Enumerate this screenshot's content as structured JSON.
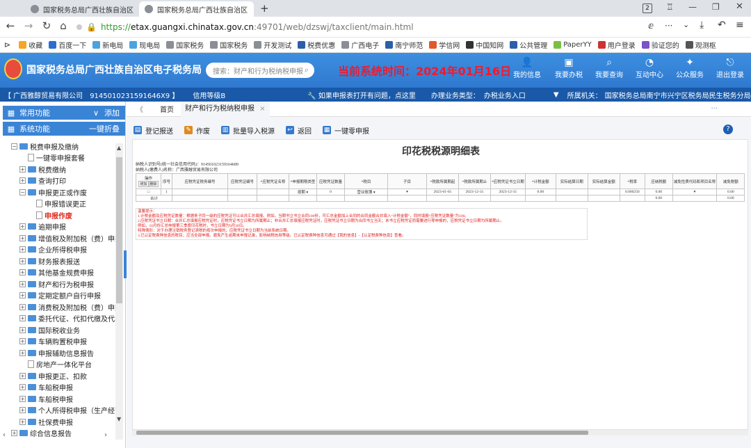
{
  "browser": {
    "tabs": [
      {
        "title": "国家税务总局广西壮族自治区",
        "active": false
      },
      {
        "title": "国家税务总局广西壮族自治区",
        "active": true
      }
    ],
    "new_tab": "+",
    "tab_count": "2",
    "url": "https://etax.guangxi.chinatax.gov.cn:49701/web/dzswj/taxclient/main.html",
    "url_scheme": "https://",
    "url_host": "etax.guangxi.chinatax.gov.cn",
    "url_rest": ":49701/web/dzswj/taxclient/main.html",
    "menu_dots": "···",
    "bookmarks": [
      {
        "label": "收藏",
        "color": "#f5a623"
      },
      {
        "label": "百度一下",
        "color": "#2c6fd1"
      },
      {
        "label": "新电局",
        "color": "#4aa3df"
      },
      {
        "label": "现电局",
        "color": "#4aa3df"
      },
      {
        "label": "国家税务",
        "color": "#8a8f96"
      },
      {
        "label": "国家税务",
        "color": "#8a8f96"
      },
      {
        "label": "开发测试",
        "color": "#8a8f96"
      },
      {
        "label": "税费优惠",
        "color": "#2b5fa8"
      },
      {
        "label": "广西电子",
        "color": "#8a8f96"
      },
      {
        "label": "南宁师范",
        "color": "#2b5fa8"
      },
      {
        "label": "学信网",
        "color": "#e0592a"
      },
      {
        "label": "中国知网",
        "color": "#333333"
      },
      {
        "label": "公共管理",
        "color": "#2b5fa8"
      },
      {
        "label": "PaperYY",
        "color": "#7cc043"
      },
      {
        "label": "用户登录",
        "color": "#cc3333"
      },
      {
        "label": "验证您的",
        "color": "#7b52c8"
      },
      {
        "label": "观测枢",
        "color": "#555555"
      }
    ]
  },
  "site": {
    "title": "国家税务总局广西壮族自治区电子税务局",
    "search_placeholder": "搜索：财产和行为税纳税申报",
    "system_time": "当前系统时间：2024年01月16日",
    "nav": [
      {
        "label": "我的信息",
        "icon": "user-icon"
      },
      {
        "label": "我要办税",
        "icon": "tax-icon"
      },
      {
        "label": "我要查询",
        "icon": "query-icon"
      },
      {
        "label": "互动中心",
        "icon": "chat-icon"
      },
      {
        "label": "公众服务",
        "icon": "service-icon"
      },
      {
        "label": "退出登录",
        "icon": "logout-icon"
      }
    ]
  },
  "infobar": {
    "company": "【 广西雅醇贸易有限公司",
    "taxid": "91450102315916​46X9 】",
    "credit": "信用等级B",
    "notice": "如果申报表打开有问题，点这里",
    "business_type_label": "办理业务类型：",
    "business_type": "办税业务入口",
    "authority_label": "所属机关：",
    "authority": "国家税务总局南宁市兴宁区税务局民生税务分局（主）"
  },
  "sidebar": {
    "common": "常用功能",
    "common_action": "添加",
    "system": "系统功能",
    "system_action": "一键折叠",
    "tree": [
      {
        "label": "税费申报及缴纳",
        "type": "folder",
        "level": 0,
        "sign": "−"
      },
      {
        "label": "一键零申报套餐",
        "type": "doc",
        "level": 1
      },
      {
        "label": "税费缴纳",
        "type": "folder",
        "level": 1,
        "sign": "+"
      },
      {
        "label": "查询打印",
        "type": "folder",
        "level": 1,
        "sign": "+"
      },
      {
        "label": "申报更正或作废",
        "type": "folder",
        "level": 1,
        "sign": "−"
      },
      {
        "label": "申报错误更正",
        "type": "doc",
        "level": 2
      },
      {
        "label": "申报作废",
        "type": "doc",
        "level": 2,
        "selected": true
      },
      {
        "label": "逾期申报",
        "type": "folder",
        "level": 1,
        "sign": "+"
      },
      {
        "label": "增值税及附加税（费）申报",
        "type": "folder",
        "level": 1,
        "sign": "+"
      },
      {
        "label": "企业所得税申报",
        "type": "folder",
        "level": 1,
        "sign": "+"
      },
      {
        "label": "财务报表报送",
        "type": "folder",
        "level": 1,
        "sign": "+"
      },
      {
        "label": "其他基金规费申报",
        "type": "folder",
        "level": 1,
        "sign": "+"
      },
      {
        "label": "财产和行为税申报",
        "type": "folder",
        "level": 1,
        "sign": "+"
      },
      {
        "label": "定期定额户自行申报",
        "type": "folder",
        "level": 1,
        "sign": "+"
      },
      {
        "label": "消费税及附加税（费）申报",
        "type": "folder",
        "level": 1,
        "sign": "+"
      },
      {
        "label": "委托代征、代扣代缴及代收",
        "type": "folder",
        "level": 1,
        "sign": "+"
      },
      {
        "label": "国际税收业务",
        "type": "folder",
        "level": 1,
        "sign": "+"
      },
      {
        "label": "车辆购置税申报",
        "type": "folder",
        "level": 1,
        "sign": "+"
      },
      {
        "label": "申报辅助信息报告",
        "type": "folder",
        "level": 1,
        "sign": "+"
      },
      {
        "label": "房地产一体化平台",
        "type": "doc",
        "level": 1
      },
      {
        "label": "申报更正、扣款",
        "type": "folder",
        "level": 1,
        "sign": "+"
      },
      {
        "label": "车船税申报",
        "type": "folder",
        "level": 1,
        "sign": "+"
      },
      {
        "label": "车船税申报",
        "type": "folder",
        "level": 1,
        "sign": "+"
      },
      {
        "label": "个人所得税申报（生产经营",
        "type": "folder",
        "level": 1,
        "sign": "+"
      },
      {
        "label": "社保费申报",
        "type": "folder",
        "level": 1,
        "sign": "+"
      },
      {
        "label": "综合信息报告",
        "type": "folder",
        "level": 0,
        "sign": "+"
      }
    ]
  },
  "content": {
    "collapse": "《",
    "tabs": [
      "首页",
      "财产和行为税纳税申报"
    ],
    "tab_close": "×",
    "more": "···",
    "toolbar": [
      {
        "label": "登记报送",
        "icon": "register-icon"
      },
      {
        "label": "作废",
        "icon": "void-icon"
      },
      {
        "label": "批量导入税源",
        "icon": "import-icon"
      },
      {
        "label": "返回",
        "icon": "back-icon"
      },
      {
        "label": "一键零申报",
        "icon": "zero-declare-icon"
      }
    ],
    "help": "?",
    "form": {
      "title": "印花税税源明细表",
      "taxpayer_id": "纳税人识别号(统一社会信用代码)：91450102315916​4689",
      "taxpayer_name": "纳税人(缴费人)名称：广西雅醇贸易有限公司",
      "headers": [
        "操作",
        "序号",
        "应税凭证税务编号",
        "应税凭证编号",
        "*应税凭证名称",
        "*申报期限类型",
        "应税凭证数量",
        "*税目",
        "子目",
        "*税款所属期起",
        "*税款所属期止",
        "*应税凭证书立日期",
        "*计税金额",
        "实际结算日期",
        "实际结算金额",
        "*税率",
        "应纳税额",
        "减免性质代码和项目名称",
        "减免税额"
      ],
      "op_buttons": [
        "增加",
        "删除"
      ],
      "row": [
        "1",
        "",
        "",
        "",
        "按期",
        "0",
        "营业账簿",
        "",
        "2023-01-01",
        "2023-12-31",
        "2023-12-31",
        "0.00",
        "",
        "",
        "0.000250",
        "0.00",
        "",
        "0.00"
      ],
      "total_label": "合计",
      "total_tax": "0.00",
      "total_relief": "0.00",
      "notes": [
        "温馨提示：",
        "1.计税金额及应税凭证数量：根据条子同一级的应税凭证可以合并汇总填报。例如，当期书立书立合同100份，可汇总金额加上合同的合同金额合并填入“计税金额”，同时填报“应税凭证数量”为100。",
        "2.应税凭证书立日期：合并汇总填报应税凭证时，应税凭证书立日期为所属期止；非合并汇总填报应税凭证时，应税凭证书立日期为合同书立当天；未书立应税凭证而需要进行零申报的，应税凭证书立日期为所属期止。",
        "例如，10月份汇总申报第三季度印花税时，书立日期为9月30日。",
        "特殊情形：对于办理注销税务登记清税的按次申报的，应税凭证书立日期为当前系统日期。",
        "3.已认定税费种信息的税目，应当全部申报。避免产生逾期未申报记录，影响纳税信用等级。已认定税费种信息可通过【我的信息】-【认定税费种信息】查看。"
      ]
    }
  }
}
